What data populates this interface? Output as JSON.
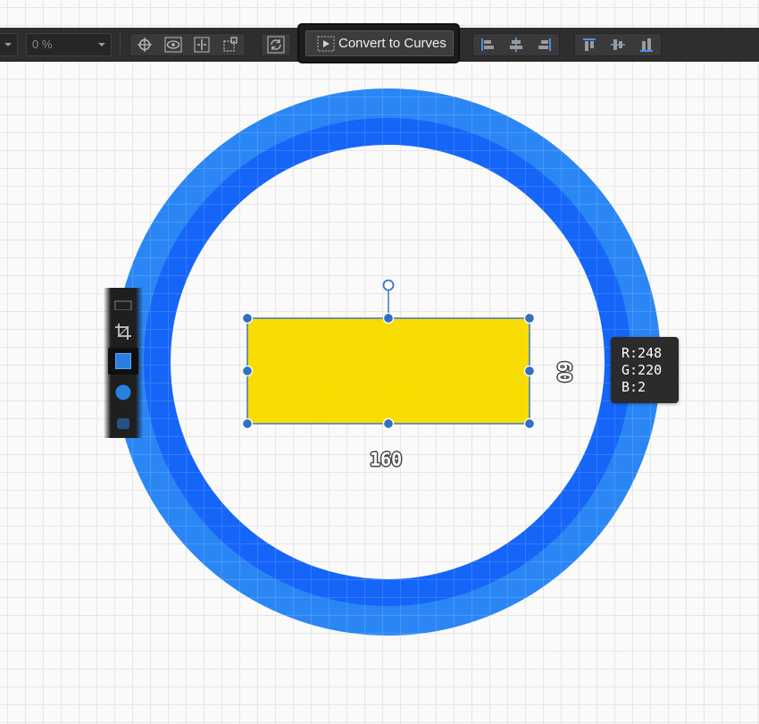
{
  "toolbar": {
    "opacity_value": "0 %",
    "convert_to_curves_label": "Convert to Curves",
    "snap_icons": [
      "crosshair-icon",
      "eye-icon",
      "distribute-icon",
      "transform-box-icon"
    ],
    "cycle_icon": "cycle-icon",
    "align_horizontal_icons": [
      "align-left-icon",
      "align-center-icon",
      "align-right-icon"
    ],
    "align_vertical_icons": [
      "align-top-icon",
      "align-middle-icon",
      "align-bottom-icon"
    ]
  },
  "tools": [
    {
      "name": "crop-tool",
      "icon": "crop-icon"
    },
    {
      "name": "rectangle-tool",
      "icon": "square-icon",
      "active": true
    },
    {
      "name": "ellipse-tool",
      "icon": "circle-icon"
    }
  ],
  "canvas": {
    "ring_colors": {
      "outer": "#2a86f4",
      "inner": "#1565f9"
    },
    "rectangle_fill": "#f8dc02",
    "selection_color": "#3a78c4",
    "width_label": "160",
    "height_label": "60"
  },
  "color_readout": {
    "r": "R:248",
    "g": "G:220",
    "b": "B:2"
  }
}
